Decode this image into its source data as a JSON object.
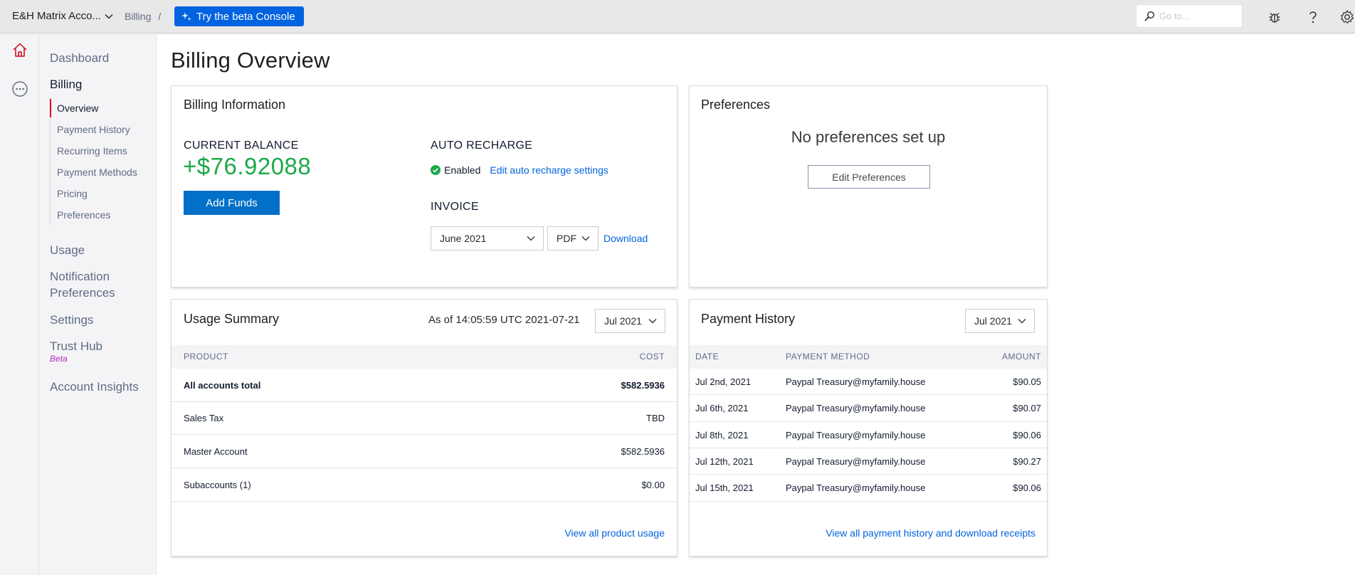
{
  "topbar": {
    "account_name": "E&H Matrix Acco...",
    "breadcrumb": "Billing",
    "breadcrumb_sep": "/",
    "beta_button": "Try the beta Console",
    "search_placeholder": "Go to..."
  },
  "nav": {
    "dashboard": "Dashboard",
    "billing": "Billing",
    "billing_items": [
      "Overview",
      "Payment History",
      "Recurring Items",
      "Payment Methods",
      "Pricing",
      "Preferences"
    ],
    "usage": "Usage",
    "notification_line1": "Notification",
    "notification_line2": "Preferences",
    "settings": "Settings",
    "trust_hub": "Trust Hub",
    "trust_hub_badge": "Beta",
    "account_insights": "Account Insights"
  },
  "page": {
    "title": "Billing Overview"
  },
  "billing_info": {
    "title": "Billing Information",
    "balance_label": "CURRENT BALANCE",
    "balance_value": "+$76.92088",
    "add_funds": "Add Funds",
    "auto_recharge_label": "AUTO RECHARGE",
    "auto_recharge_status": "Enabled",
    "auto_recharge_link": "Edit auto recharge settings",
    "invoice_label": "INVOICE",
    "invoice_month": "June 2021",
    "invoice_format": "PDF",
    "download": "Download"
  },
  "preferences": {
    "title": "Preferences",
    "empty": "No preferences set up",
    "edit_button": "Edit Preferences"
  },
  "usage_summary": {
    "title": "Usage Summary",
    "as_of": "As of 14:05:59 UTC 2021-07-21",
    "period": "Jul 2021",
    "col_product": "PRODUCT",
    "col_cost": "COST",
    "rows": [
      {
        "product": "All accounts total",
        "cost": "$582.5936"
      },
      {
        "product": "Sales Tax",
        "cost": "TBD"
      },
      {
        "product": "Master Account",
        "cost": "$582.5936"
      },
      {
        "product": "Subaccounts (1)",
        "cost": "$0.00"
      }
    ],
    "view_all": "View all product usage"
  },
  "payment_history": {
    "title": "Payment History",
    "period": "Jul 2021",
    "col_date": "DATE",
    "col_method": "PAYMENT METHOD",
    "col_amount": "AMOUNT",
    "rows": [
      {
        "date": "Jul 2nd, 2021",
        "method": "Paypal Treasury@myfamily.house",
        "amount": "$90.05"
      },
      {
        "date": "Jul 6th, 2021",
        "method": "Paypal Treasury@myfamily.house",
        "amount": "$90.07"
      },
      {
        "date": "Jul 8th, 2021",
        "method": "Paypal Treasury@myfamily.house",
        "amount": "$90.06"
      },
      {
        "date": "Jul 12th, 2021",
        "method": "Paypal Treasury@myfamily.house",
        "amount": "$90.27"
      },
      {
        "date": "Jul 15th, 2021",
        "method": "Paypal Treasury@myfamily.house",
        "amount": "$90.06"
      }
    ],
    "view_all": "View all payment history and download receipts"
  },
  "colors": {
    "accent": "#0263e0",
    "balance_green": "#1ea84a",
    "active_marker": "#d6001c",
    "beta_purple": "#b429c1"
  }
}
